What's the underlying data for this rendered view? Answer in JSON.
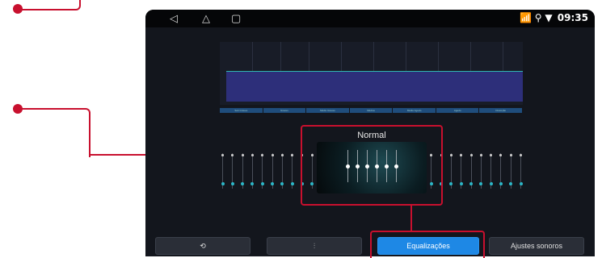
{
  "status_bar": {
    "back_icon": "◁",
    "home_icon": "△",
    "recents_icon": "▢",
    "status_icons": "📶 ⚲ ▼",
    "time": "09:35"
  },
  "eq_graph": {
    "bands": [
      "Sub Graves",
      "Graves",
      "Médio Graves",
      "Médios",
      "Médio Agudo",
      "Agudo",
      "Distorção"
    ]
  },
  "preset": {
    "title": "Normal"
  },
  "bottom_bar": {
    "loop_icon": "⟲",
    "sliders_icon": "⫶",
    "equalizations_label": "Equalizações",
    "sound_settings_label": "Ajustes sonoros"
  },
  "colors": {
    "highlight": "#c8102e",
    "accent": "#1e88e5",
    "dot": "#2bb8c8"
  }
}
